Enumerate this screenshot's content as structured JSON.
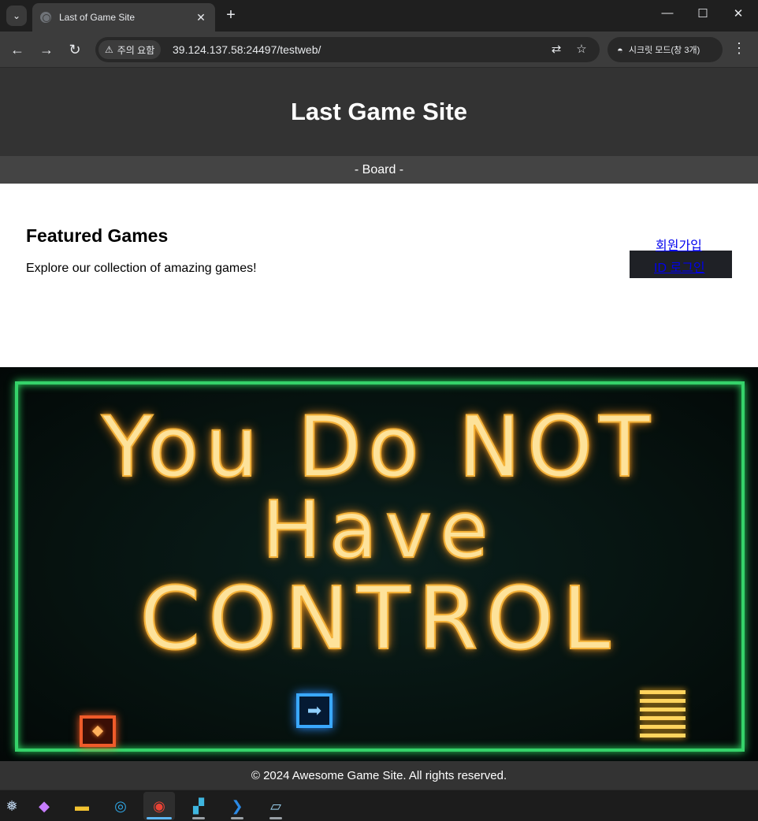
{
  "browser": {
    "tab_title": "Last of Game Site",
    "tab_close": "✕",
    "new_tab": "+",
    "security_label": "주의 요함",
    "url": "39.124.137.58:24497/testweb/",
    "incognito_label": "시크릿 모드(창 3개)",
    "icons": [
      "tab-search-icon",
      "favicon-globe-icon",
      "back-icon",
      "forward-icon",
      "reload-icon",
      "warning-icon",
      "translate-icon",
      "star-icon",
      "incognito-icon",
      "menu-dots-icon",
      "minimize-icon",
      "maximize-icon",
      "close-window-icon"
    ]
  },
  "site": {
    "title": "Last Game Site",
    "nav_board": "- Board -",
    "featured_title": "Featured Games",
    "featured_desc": "Explore our collection of amazing games!",
    "signup_link": "회원가입",
    "login_link": "ID 로그인",
    "banner": {
      "line1": "You Do NOT",
      "line2": "Have",
      "line3": "CONTROL"
    },
    "footer": "© 2024 Awesome Game Site. All rights reserved."
  },
  "taskbar": {
    "items": [
      "start-icon",
      "copilot-icon",
      "file-explorer-icon",
      "edge-icon",
      "chrome-icon",
      "visual-studio-icon",
      "vscode-icon",
      "notepad-icon"
    ]
  },
  "colors": {
    "header_bg": "#333333",
    "nav_bg": "#444444",
    "banner_frame": "#35d26a",
    "banner_text": "#fde29a",
    "link": "#0000ee"
  }
}
